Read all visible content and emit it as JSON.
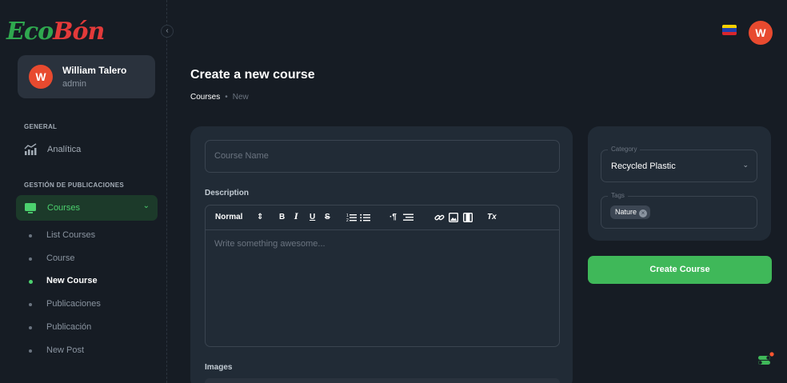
{
  "logo": {
    "part1": "Eco",
    "part2": "Bón"
  },
  "user": {
    "initial": "W",
    "name": "William Talero",
    "role": "admin"
  },
  "sidebar": {
    "section_general": "GENERAL",
    "analytics_label": "Analítica",
    "section_publications": "GESTIÓN DE PUBLICACIONES",
    "courses_label": "Courses",
    "sub_items": [
      {
        "label": "List Courses"
      },
      {
        "label": "Course"
      },
      {
        "label": "New Course"
      },
      {
        "label": "Publicaciones"
      },
      {
        "label": "Publicación"
      },
      {
        "label": "New Post"
      }
    ]
  },
  "header": {
    "avatar_initial": "W"
  },
  "page": {
    "title": "Create a new course",
    "breadcrumb": [
      "Courses",
      "New"
    ]
  },
  "form": {
    "course_name_placeholder": "Course Name",
    "description_label": "Description",
    "toolbar": {
      "format": "Normal",
      "bold": "B",
      "italic": "I",
      "underline": "U",
      "strike": "S",
      "clear": "Tx"
    },
    "editor_placeholder": "Write something awesome...",
    "images_label": "Images"
  },
  "side": {
    "category_label": "Category",
    "category_value": "Recycled Plastic",
    "tags_label": "Tags",
    "tags": [
      "Nature"
    ],
    "create_button": "Create Course"
  },
  "colors": {
    "background": "#161c24",
    "card": "#212b36",
    "accent_green": "#3fb859",
    "avatar": "#e84a2f"
  }
}
